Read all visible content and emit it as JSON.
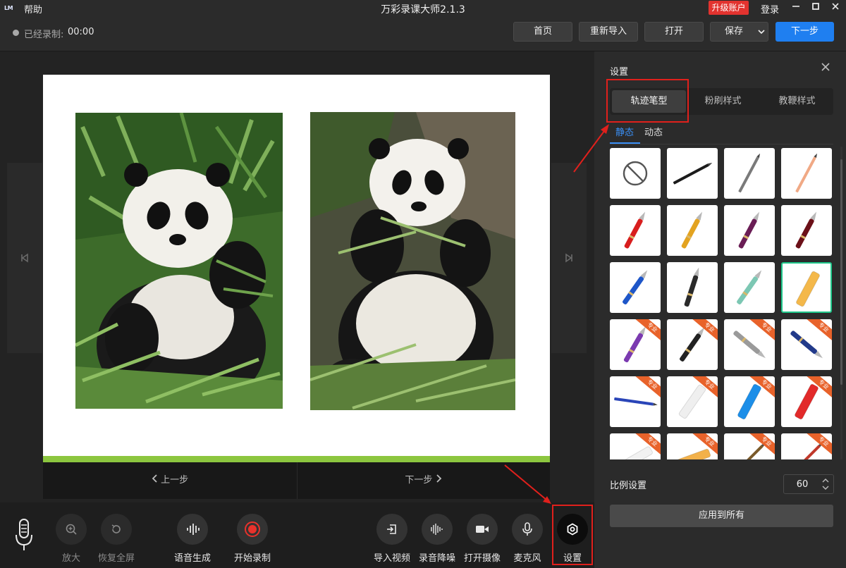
{
  "app": {
    "title": "万彩录课大师2.1.3",
    "logo": "LM",
    "help": "帮助",
    "upgrade": "升级账户",
    "login": "登录",
    "window_buttons": [
      "minimize-icon",
      "maximize-icon",
      "close-icon"
    ]
  },
  "toolbar": {
    "recorded_label": "已经录制:",
    "recorded_time": "00:00",
    "home": "首页",
    "reimport": "重新导入",
    "open": "打开",
    "save": "保存",
    "next": "下一步"
  },
  "slide_nav": {
    "prev": "上一步",
    "next": "下一步"
  },
  "bottom_tools": {
    "zoom_in": "放大",
    "restore_fullscreen": "恢复全屏",
    "voice_generate": "语音生成",
    "start_record": "开始录制",
    "import_video": "导入视频",
    "noise_reduction": "录音降噪",
    "open_camera": "打开摄像",
    "microphone": "麦克风",
    "settings": "设置"
  },
  "settings_panel": {
    "title": "设置",
    "tabs": [
      "轨迹笔型",
      "粉刷样式",
      "教鞭样式"
    ],
    "active_tab": 0,
    "subtabs": [
      "静态",
      "动态"
    ],
    "active_subtab": 0,
    "pro_badge": "专业",
    "pen_styles": [
      {
        "name": "none-icon",
        "pro": false
      },
      {
        "name": "black-pencil-icon",
        "pro": false
      },
      {
        "name": "gray-pencil-icon",
        "pro": false
      },
      {
        "name": "peach-pencil-icon",
        "pro": false
      },
      {
        "name": "red-pen-icon",
        "pro": false
      },
      {
        "name": "yellow-pen-icon",
        "pro": false
      },
      {
        "name": "purple-pen-icon",
        "pro": false
      },
      {
        "name": "dark-red-pen-icon",
        "pro": false
      },
      {
        "name": "blue-fountain-pen-icon",
        "pro": false
      },
      {
        "name": "black-marker-icon",
        "pro": false
      },
      {
        "name": "teal-pen-icon",
        "pro": false
      },
      {
        "name": "yellow-chalk-icon",
        "pro": false,
        "selected": true
      },
      {
        "name": "purple-crayon-icon",
        "pro": true
      },
      {
        "name": "black-fountain-pen-icon",
        "pro": true
      },
      {
        "name": "silver-pen-icon",
        "pro": true
      },
      {
        "name": "navy-pen-icon",
        "pro": true
      },
      {
        "name": "blue-pencil-icon",
        "pro": true
      },
      {
        "name": "white-chalk-icon",
        "pro": true
      },
      {
        "name": "blue-chalk-icon",
        "pro": true
      },
      {
        "name": "red-chalk-icon",
        "pro": true
      },
      {
        "name": "white-stick-icon",
        "pro": true
      },
      {
        "name": "orange-stick-icon",
        "pro": true
      },
      {
        "name": "brush-icon",
        "pro": true
      },
      {
        "name": "red-brush-icon",
        "pro": true
      }
    ],
    "ratio_label": "比例设置",
    "ratio_value": "60",
    "apply_all": "应用到所有"
  },
  "colors": {
    "accent": "#1f7ff0",
    "highlight": "#e0201c",
    "slide_bar": "#8cc63f",
    "upgrade": "#e2332f",
    "record": "#e8322c"
  }
}
